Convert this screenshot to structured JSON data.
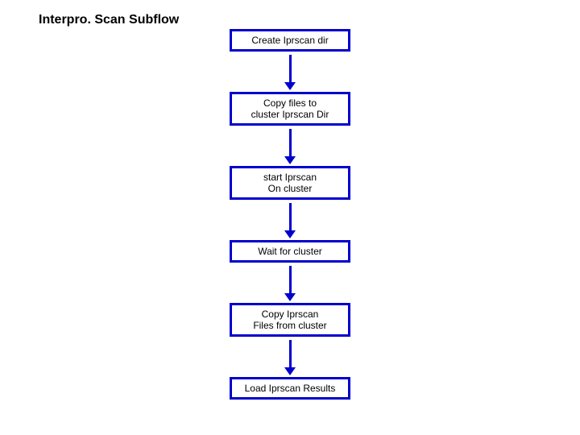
{
  "title": "Interpro. Scan Subflow",
  "chart_data": {
    "type": "flowchart",
    "direction": "top-to-bottom",
    "nodes": [
      {
        "id": "n1",
        "label_lines": [
          "Create Iprscan dir"
        ]
      },
      {
        "id": "n2",
        "label_lines": [
          "Copy files to",
          "cluster Iprscan Dir"
        ]
      },
      {
        "id": "n3",
        "label_lines": [
          "start Iprscan",
          "On cluster"
        ]
      },
      {
        "id": "n4",
        "label_lines": [
          "Wait for cluster"
        ]
      },
      {
        "id": "n5",
        "label_lines": [
          "Copy Iprscan",
          "Files from cluster"
        ]
      },
      {
        "id": "n6",
        "label_lines": [
          "Load Iprscan Results"
        ]
      }
    ],
    "edges": [
      {
        "from": "n1",
        "to": "n2"
      },
      {
        "from": "n2",
        "to": "n3"
      },
      {
        "from": "n3",
        "to": "n4"
      },
      {
        "from": "n4",
        "to": "n5"
      },
      {
        "from": "n5",
        "to": "n6"
      }
    ],
    "style": {
      "node_border_color": "#0000cd",
      "node_fill_color": "#ffffff",
      "arrow_color": "#0000cd"
    }
  }
}
